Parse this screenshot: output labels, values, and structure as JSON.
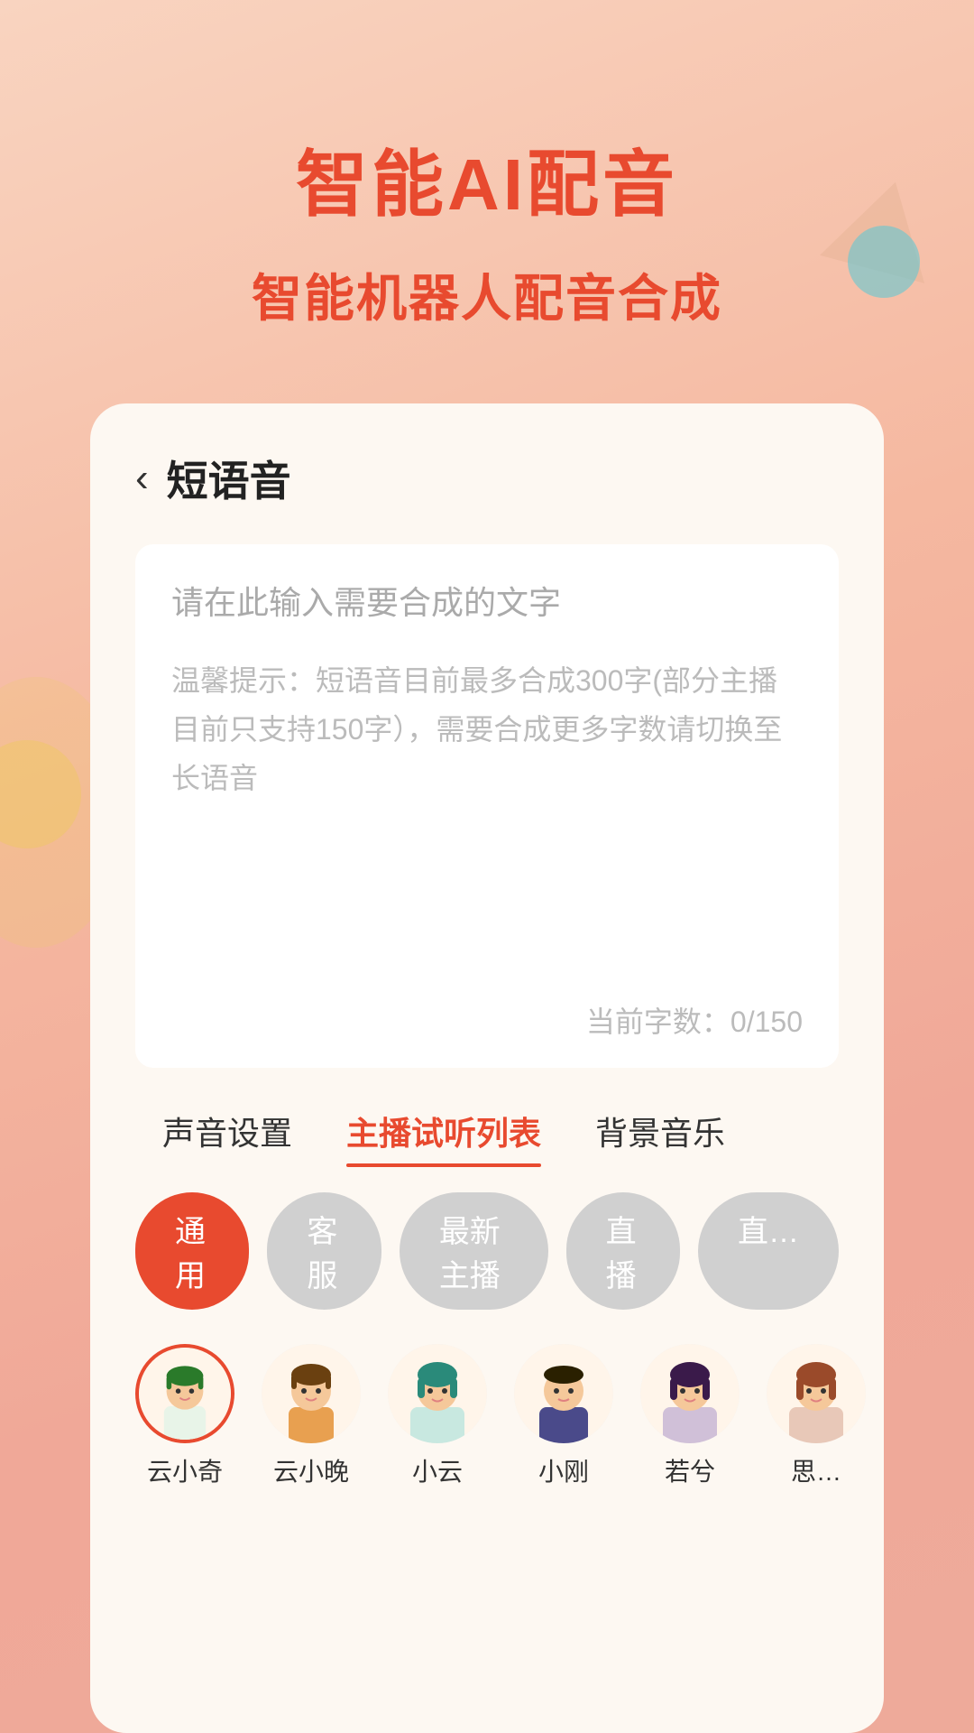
{
  "header": {
    "main_title": "智能AI配音",
    "sub_title": "智能机器人配音合成"
  },
  "card": {
    "back_label": "‹",
    "title": "短语音",
    "textarea": {
      "placeholder": "请在此输入需要合成的文字",
      "hint": "温馨提示：短语音目前最多合成300字(部分主播目前只支持150字），需要合成更多字数请切换至长语音",
      "char_count_label": "当前字数：0/150"
    },
    "tabs": [
      {
        "label": "声音设置",
        "active": false
      },
      {
        "label": "主播试听列表",
        "active": true
      },
      {
        "label": "背景音乐",
        "active": false
      }
    ],
    "pills": [
      {
        "label": "通用",
        "active": true
      },
      {
        "label": "客服",
        "active": false
      },
      {
        "label": "最新主播",
        "active": false
      },
      {
        "label": "直播",
        "active": false
      },
      {
        "label": "直…",
        "active": false
      }
    ],
    "avatars": [
      {
        "name": "云小奇",
        "selected": true,
        "emoji": "🧑",
        "hair_color": "#2a7a2a",
        "skin": "#f5c89a"
      },
      {
        "name": "云小晚",
        "selected": false,
        "emoji": "👦",
        "hair_color": "#4a3000",
        "skin": "#f5c89a"
      },
      {
        "name": "小云",
        "selected": false,
        "emoji": "👩",
        "hair_color": "#2a8a7a",
        "skin": "#f5c89a"
      },
      {
        "name": "小刚",
        "selected": false,
        "emoji": "👨",
        "hair_color": "#3a2a00",
        "skin": "#f5c89a"
      },
      {
        "name": "若兮",
        "selected": false,
        "emoji": "👩",
        "hair_color": "#2a0a2a",
        "skin": "#f5c89a"
      },
      {
        "name": "思…",
        "selected": false,
        "emoji": "👩",
        "hair_color": "#8a3a2a",
        "skin": "#f5c89a"
      }
    ]
  }
}
